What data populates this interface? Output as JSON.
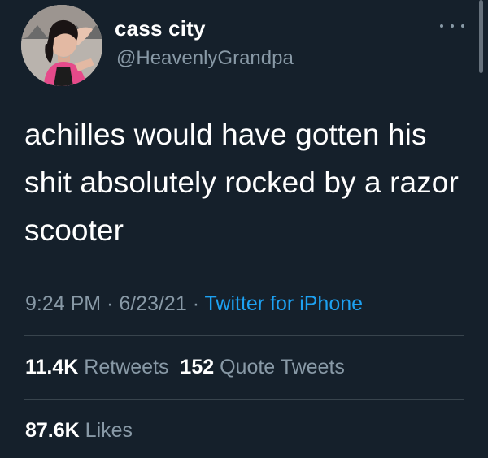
{
  "user": {
    "display_name": "cass city",
    "handle": "@HeavenlyGrandpa",
    "avatar_icon": "profile-photo",
    "more_icon": "more-horizontal-icon"
  },
  "tweet": {
    "text": "achilles would have gotten his shit absolutely rocked by a razor scooter"
  },
  "meta": {
    "time": "9:24 PM",
    "sep1": " · ",
    "date": "6/23/21",
    "sep2": " · ",
    "source": "Twitter for iPhone"
  },
  "stats": {
    "retweets_count": "11.4K",
    "retweets_label": "Retweets",
    "quotes_count": "152",
    "quotes_label": "Quote Tweets",
    "likes_count": "87.6K",
    "likes_label": "Likes"
  },
  "colors": {
    "background": "#15202b",
    "secondary_text": "#8899a6",
    "link": "#1da1f2",
    "divider": "#38444d"
  }
}
